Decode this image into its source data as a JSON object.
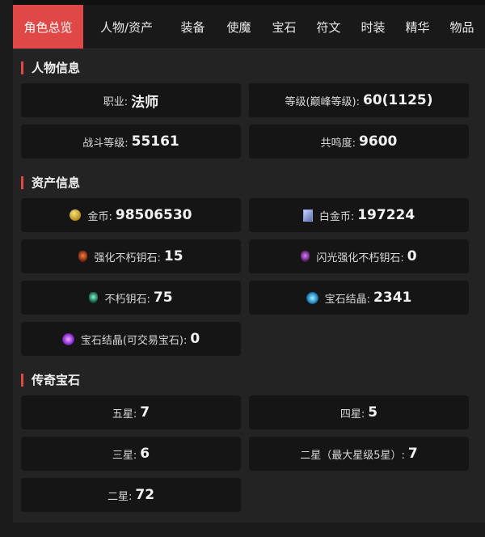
{
  "tabs": [
    {
      "label": "角色总览",
      "active": true
    },
    {
      "label": "人物/资产"
    },
    {
      "label": "装备"
    },
    {
      "label": "使魔"
    },
    {
      "label": "宝石"
    },
    {
      "label": "符文"
    },
    {
      "label": "时装"
    },
    {
      "label": "精华"
    },
    {
      "label": "物品"
    }
  ],
  "sections": {
    "character": {
      "title": "人物信息",
      "items": [
        {
          "label": "职业:",
          "value": "法师"
        },
        {
          "label": "等级(巅峰等级):",
          "value": "60(1125)"
        },
        {
          "label": "战斗等级:",
          "value": "55161"
        },
        {
          "label": "共鸣度:",
          "value": "9600"
        }
      ]
    },
    "assets": {
      "title": "资产信息",
      "items": [
        {
          "label": "金币:",
          "value": "98506530",
          "icon": "gold-coin-icon"
        },
        {
          "label": "白金币:",
          "value": "197224",
          "icon": "platinum-coin-icon"
        },
        {
          "label": "强化不朽钥石:",
          "value": "15",
          "icon": "enhanced-eternal-keystone-icon"
        },
        {
          "label": "闪光强化不朽钥石:",
          "value": "0",
          "icon": "shining-keystone-icon"
        },
        {
          "label": "不朽钥石:",
          "value": "75",
          "icon": "eternal-keystone-icon"
        },
        {
          "label": "宝石结晶:",
          "value": "2341",
          "icon": "gem-crystal-icon"
        },
        {
          "label": "宝石结晶(可交易宝石):",
          "value": "0",
          "icon": "tradable-gem-crystal-icon"
        }
      ]
    },
    "gems": {
      "title": "传奇宝石",
      "items": [
        {
          "label": "五星:",
          "value": "7"
        },
        {
          "label": "四星:",
          "value": "5"
        },
        {
          "label": "三星:",
          "value": "6"
        },
        {
          "label": "二星（最大星级5星）:",
          "value": "7"
        },
        {
          "label": "二星:",
          "value": "72"
        }
      ]
    }
  }
}
